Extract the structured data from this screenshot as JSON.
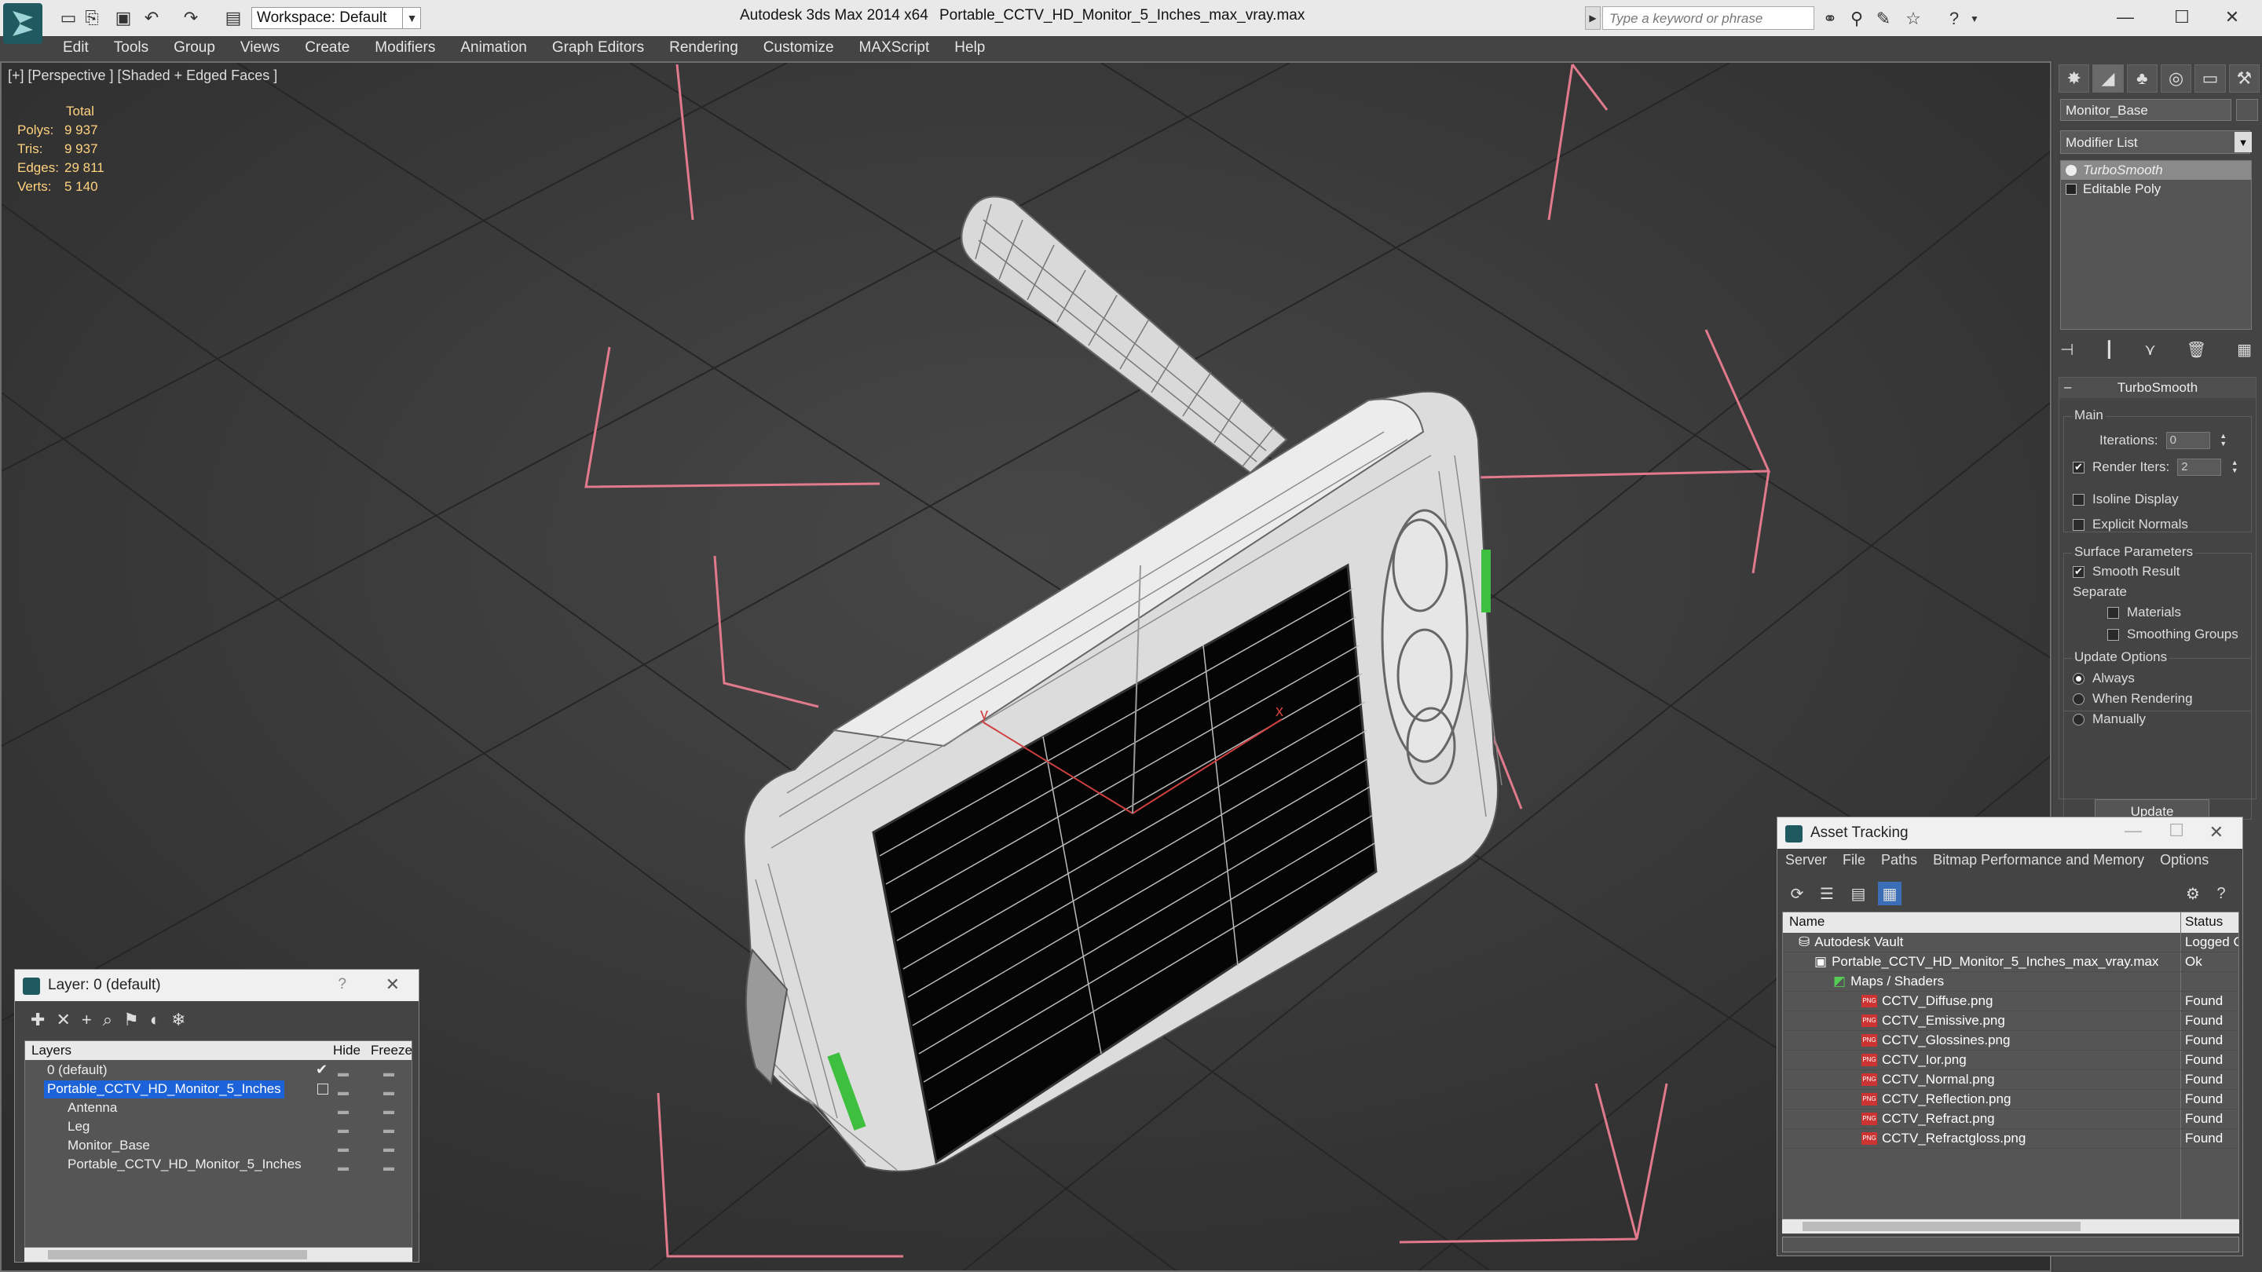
{
  "titlebar": {
    "workspace": "Workspace: Default",
    "app_name": "Autodesk 3ds Max  2014 x64",
    "file_name": "Portable_CCTV_HD_Monitor_5_Inches_max_vray.max",
    "search_placeholder": "Type a keyword or phrase"
  },
  "menu": [
    "Edit",
    "Tools",
    "Group",
    "Views",
    "Create",
    "Modifiers",
    "Animation",
    "Graph Editors",
    "Rendering",
    "Customize",
    "MAXScript",
    "Help"
  ],
  "viewport": {
    "label": "[+] [Perspective ] [Shaded + Edged Faces ]",
    "stats": {
      "header": "Total",
      "polys_label": "Polys:",
      "polys": "9 937",
      "tris_label": "Tris:",
      "tris": "9 937",
      "edges_label": "Edges:",
      "edges": "29 811",
      "verts_label": "Verts:",
      "verts": "5 140"
    }
  },
  "command_panel": {
    "object_name": "Monitor_Base",
    "modifier_list": "Modifier List",
    "stack": [
      "TurboSmooth",
      "Editable Poly"
    ],
    "turbosmooth": {
      "title": "TurboSmooth",
      "main": "Main",
      "iterations_label": "Iterations:",
      "iterations": "0",
      "render_iters_label": "Render Iters:",
      "render_iters": "2",
      "isoline": "Isoline Display",
      "explicit_normals": "Explicit Normals",
      "surface_params": "Surface Parameters",
      "smooth_result": "Smooth Result",
      "separate": "Separate",
      "materials": "Materials",
      "smoothing_groups": "Smoothing Groups",
      "update_options": "Update Options",
      "always": "Always",
      "when_rendering": "When Rendering",
      "manually": "Manually",
      "update_button": "Update"
    }
  },
  "layer_window": {
    "title": "Layer: 0 (default)",
    "help": "?",
    "col_layers": "Layers",
    "col_hide": "Hide",
    "col_freeze": "Freeze",
    "rows": [
      {
        "name": "0 (default)",
        "indent": 0
      },
      {
        "name": "Portable_CCTV_HD_Monitor_5_Inches",
        "indent": 0
      },
      {
        "name": "Antenna",
        "indent": 1
      },
      {
        "name": "Leg",
        "indent": 1
      },
      {
        "name": "Monitor_Base",
        "indent": 1
      },
      {
        "name": "Portable_CCTV_HD_Monitor_5_Inches",
        "indent": 1
      }
    ]
  },
  "asset_window": {
    "title": "Asset Tracking",
    "menu": [
      "Server",
      "File",
      "Paths",
      "Bitmap Performance and Memory",
      "Options"
    ],
    "col_name": "Name",
    "col_status": "Status",
    "rows": [
      {
        "name": "Autodesk Vault",
        "status": "Logged C"
      },
      {
        "name": "Portable_CCTV_HD_Monitor_5_Inches_max_vray.max",
        "status": "Ok"
      },
      {
        "name": "Maps / Shaders",
        "status": ""
      },
      {
        "name": "CCTV_Diffuse.png",
        "status": "Found"
      },
      {
        "name": "CCTV_Emissive.png",
        "status": "Found"
      },
      {
        "name": "CCTV_Glossines.png",
        "status": "Found"
      },
      {
        "name": "CCTV_Ior.png",
        "status": "Found"
      },
      {
        "name": "CCTV_Normal.png",
        "status": "Found"
      },
      {
        "name": "CCTV_Reflection.png",
        "status": "Found"
      },
      {
        "name": "CCTV_Refract.png",
        "status": "Found"
      },
      {
        "name": "CCTV_Refractgloss.png",
        "status": "Found"
      }
    ]
  },
  "colors": {
    "stats": "#ffd27f",
    "selection": "#1c62d8",
    "gizmo": "#e07a8c"
  }
}
